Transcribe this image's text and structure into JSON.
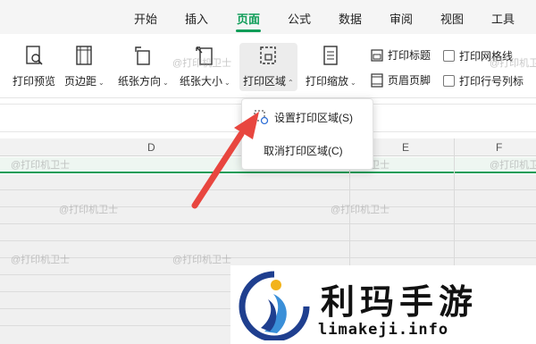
{
  "menubar": {
    "tabs": [
      "开始",
      "插入",
      "页面",
      "公式",
      "数据",
      "审阅",
      "视图",
      "工具"
    ],
    "active_tab": "页面",
    "accent_color": "#0f9d58"
  },
  "ribbon": {
    "print_preview": "打印预览",
    "margins": "页边距",
    "orientation": "纸张方向",
    "paper_size": "纸张大小",
    "print_area": "打印区域",
    "print_scaling": "打印缩放",
    "print_titles": "打印标题",
    "header_footer": "页眉页脚",
    "print_gridlines": "打印网格线",
    "print_row_col_headers": "打印行号列标"
  },
  "dropdown": {
    "set_print_area": "设置打印区域(S)",
    "clear_print_area": "取消打印区域(C)"
  },
  "sheet": {
    "columns": [
      "D",
      "E",
      "F"
    ]
  },
  "watermark": "@打印机卫士",
  "logo": {
    "title": "利玛手游",
    "url": "limakeji.info"
  },
  "annotation_color": "#e8463f"
}
